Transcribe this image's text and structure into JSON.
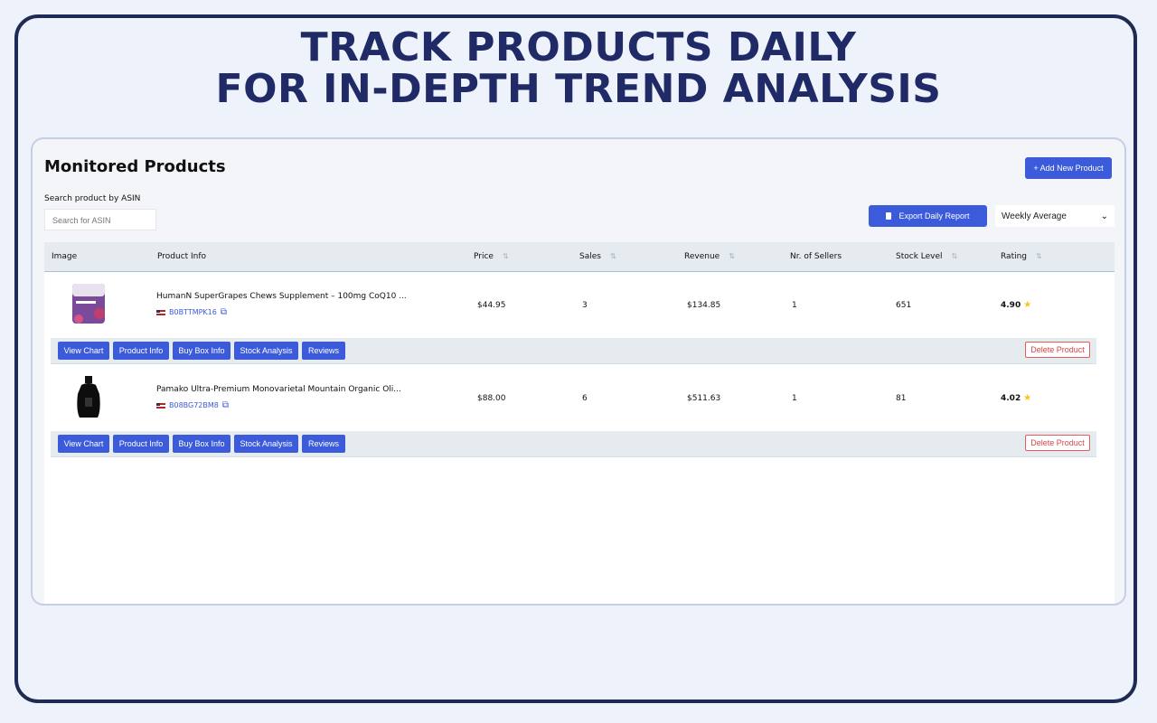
{
  "headline": {
    "line1": "TRACK PRODUCTS DAILY",
    "line2": "FOR IN-DEPTH TREND ANALYSIS"
  },
  "panel": {
    "title": "Monitored Products",
    "add_button": "+ Add New Product",
    "search_label": "Search product by ASIN",
    "search_placeholder": "Search for ASIN",
    "export_button": "Export Daily Report",
    "period_select": "Weekly Average"
  },
  "table": {
    "headers": [
      "Image",
      "Product Info",
      "Price",
      "Sales",
      "Revenue",
      "Nr. of Sellers",
      "Stock Level",
      "Rating"
    ],
    "rows": [
      {
        "name": "HumanN SuperGrapes Chews Supplement – 100mg CoQ10 ...",
        "asin": "B0BTTMPK16",
        "price": "$44.95",
        "sales": "3",
        "revenue": "$134.85",
        "sellers": "1",
        "stock": "651",
        "rating": "4.90"
      },
      {
        "name": "Pamako Ultra-Premium Monovarietal Mountain Organic Oli...",
        "asin": "B08BG72BM8",
        "price": "$88.00",
        "sales": "6",
        "revenue": "$511.63",
        "sellers": "1",
        "stock": "81",
        "rating": "4.02"
      }
    ],
    "actions": [
      "View Chart",
      "Product Info",
      "Buy Box Info",
      "Stock Analysis",
      "Reviews"
    ],
    "delete_label": "Delete Product"
  },
  "colors": {
    "accent": "#3b5bdb",
    "headline": "#1f2a66",
    "danger": "#e45b5b",
    "star": "#f5c518"
  }
}
